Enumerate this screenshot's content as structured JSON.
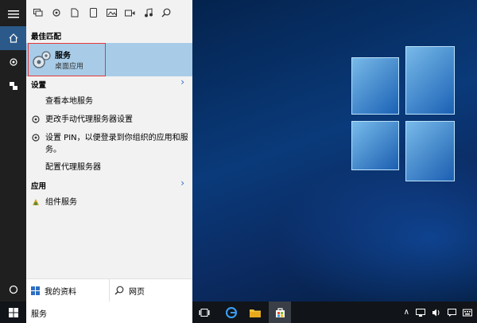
{
  "search_panel": {
    "filters": [
      "apps-icon",
      "settings-icon",
      "documents-icon",
      "tablet-icon",
      "photos-icon",
      "videos-icon",
      "music-icon",
      "web-search-icon"
    ],
    "best_match": {
      "heading": "最佳匹配",
      "title": "服务",
      "subtitle": "桌面应用"
    },
    "settings": {
      "heading": "设置",
      "items": [
        "查看本地服务",
        "更改手动代理服务器设置",
        "设置 PIN，以便登录到你组织的应用和服务。",
        "配置代理服务器"
      ]
    },
    "apps": {
      "heading": "应用",
      "items": [
        "组件服务"
      ]
    },
    "bottom": {
      "my_stuff": "我的资料",
      "web": "网页"
    }
  },
  "taskbar": {
    "search_value": "服务"
  },
  "colors": {
    "accent": "#2d6fc2",
    "selected_bg": "#a8cce8",
    "highlight_border": "#e23a3a"
  }
}
